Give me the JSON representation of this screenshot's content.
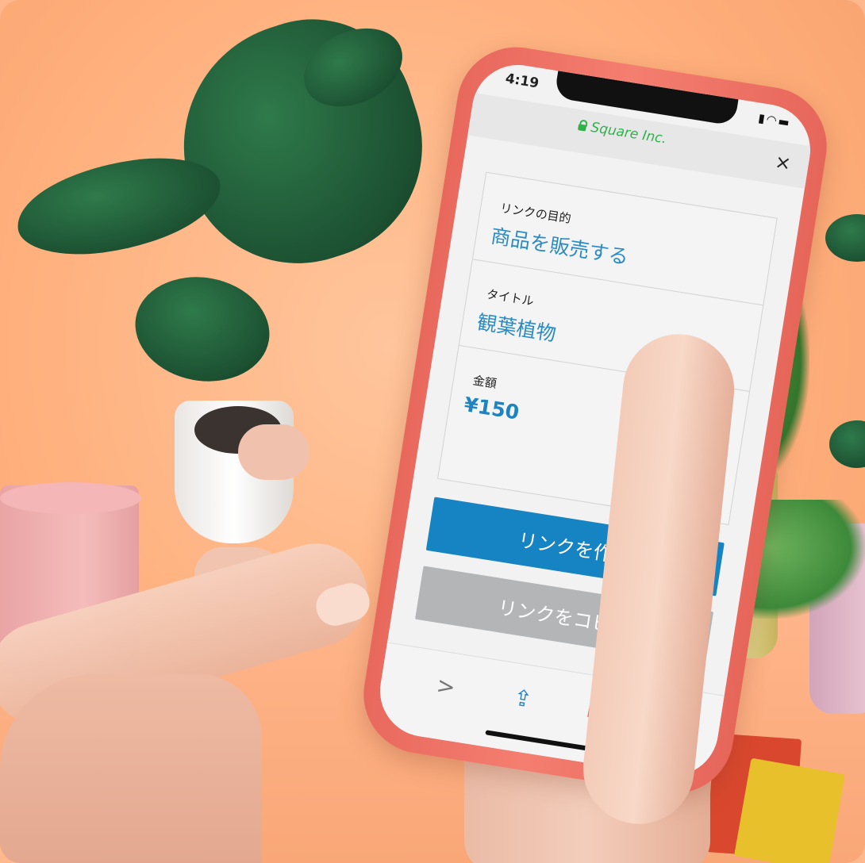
{
  "status_bar": {
    "time": "4:19",
    "signal_icon": "signal-icon",
    "wifi_icon": "wifi-icon",
    "battery_icon": "battery-icon"
  },
  "browser": {
    "site_name": "Square Inc.",
    "lock_icon": "lock-icon",
    "close_glyph": "×",
    "accent_color": "#2fb24a"
  },
  "form": {
    "purpose": {
      "label": "リンクの目的",
      "value": "商品を販売する"
    },
    "title": {
      "label": "タイトル",
      "value": "観葉植物"
    },
    "amount": {
      "label": "金額",
      "value": "¥150"
    }
  },
  "buttons": {
    "create_link": "リンクを作成",
    "copy_link": "リンクをコピー",
    "primary_color": "#1683c2",
    "disabled_color": "#b3b5b7"
  },
  "toolbar": {
    "forward_glyph": ">",
    "share_glyph": "⇪",
    "bookmarks_glyph": "📖",
    "items": [
      "forward-icon",
      "share-icon",
      "bookmarks-icon",
      "tabs-icon"
    ]
  }
}
